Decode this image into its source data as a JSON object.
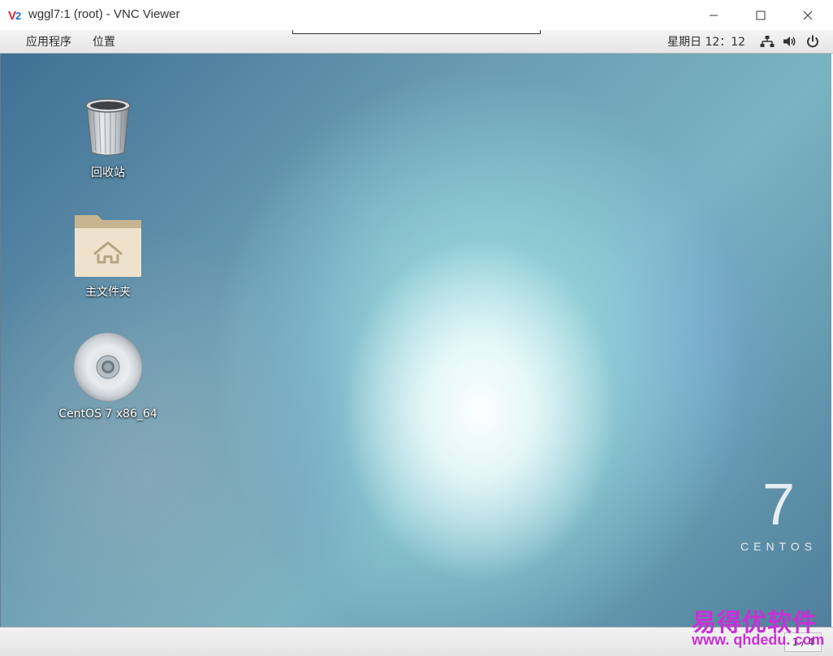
{
  "window": {
    "title": "wggl7:1 (root) - VNC Viewer",
    "logo_icon": "vnc-viewer-logo",
    "minimize_glyph": "—",
    "maximize_glyph": "☐",
    "close_glyph": "✕"
  },
  "top_panel": {
    "applications_label": "应用程序",
    "places_label": "位置",
    "clock": "星期日 12：12",
    "icons": [
      "network-icon",
      "volume-icon",
      "power-icon"
    ]
  },
  "desktop": {
    "icons": [
      {
        "label": "回收站",
        "icon": "trash-icon"
      },
      {
        "label": "主文件夹",
        "icon": "home-folder-icon"
      },
      {
        "label": "CentOS 7 x86_64",
        "icon": "disc-icon"
      }
    ],
    "branding_number": "7",
    "branding_word": "CENTOS"
  },
  "bottom_panel": {
    "workspace_indicator": "1 / 4"
  },
  "watermark": {
    "name": "易得优软件",
    "url": "www. qhdedu. com",
    "color": "#c930d6"
  }
}
